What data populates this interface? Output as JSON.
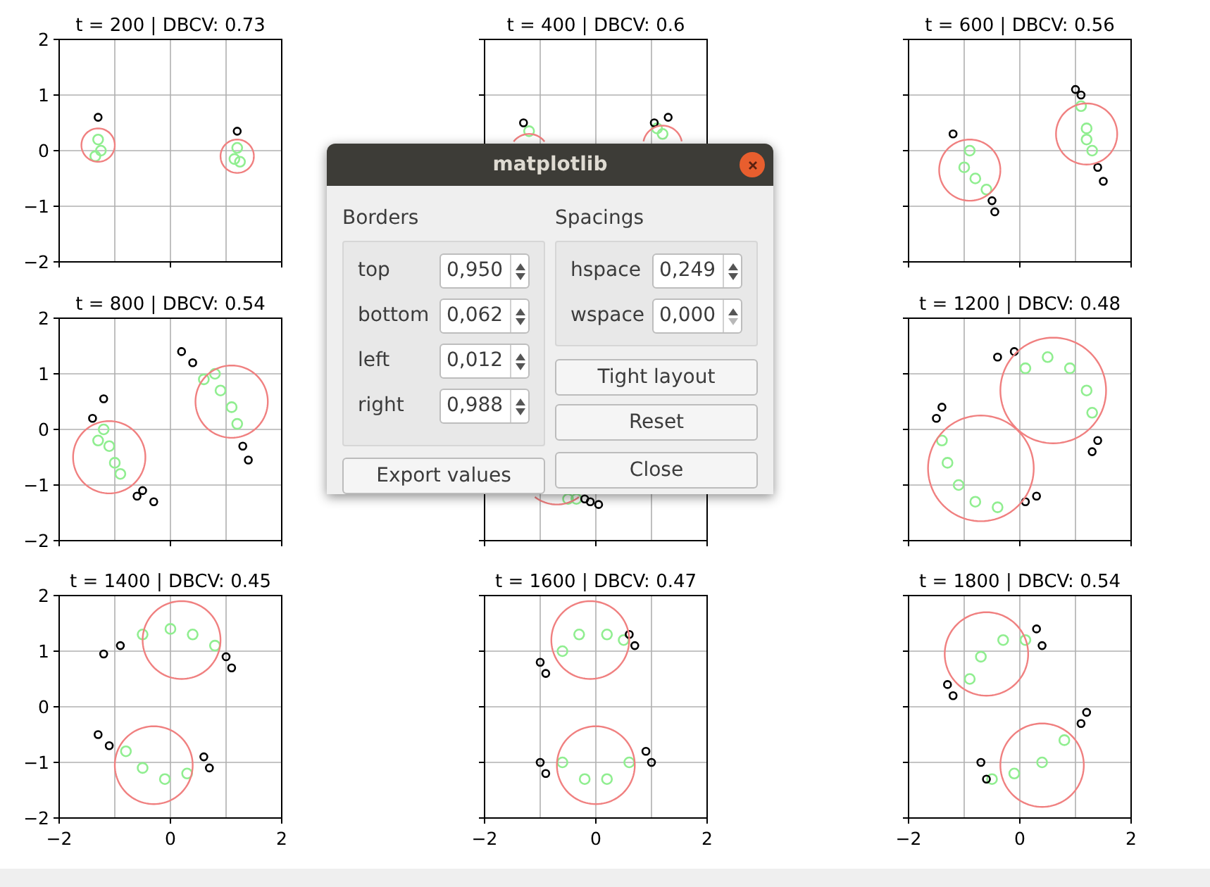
{
  "subplots": [
    {
      "chart_data": {
        "type": "scatter",
        "title": "t = 200 | DBCV: 0.73",
        "grid": true,
        "xlim": [
          -2,
          2
        ],
        "ylim": [
          -2,
          2
        ],
        "yticks": [
          {
            "value": -2,
            "label": "−2"
          },
          {
            "value": -1,
            "label": "−1"
          },
          {
            "value": 0,
            "label": "0"
          },
          {
            "value": 1,
            "label": "1"
          },
          {
            "value": 2,
            "label": "2"
          }
        ],
        "series": [
          {
            "color": "#90ee90",
            "x": [
              -1.3,
              -1.25,
              -1.35,
              1.2,
              1.15,
              1.25
            ],
            "values": [
              0.2,
              0.0,
              -0.1,
              0.05,
              -0.15,
              -0.2
            ]
          },
          {
            "color": "#000000",
            "x": [
              -1.3,
              1.2
            ],
            "values": [
              0.6,
              0.35
            ]
          }
        ]
      }
    },
    {
      "chart_data": {
        "type": "scatter",
        "title": "t = 400 | DBCV: 0.6",
        "grid": true,
        "xlim": [
          -2,
          2
        ],
        "ylim": [
          -2,
          2
        ],
        "series": [
          {
            "color": "#90ee90",
            "x": [
              1.1,
              1.2,
              -1.2
            ],
            "values": [
              0.4,
              0.3,
              0.35
            ]
          },
          {
            "color": "#000000",
            "x": [
              1.3,
              1.05,
              -1.3
            ],
            "values": [
              0.6,
              0.5,
              0.5
            ]
          }
        ]
      }
    },
    {
      "chart_data": {
        "type": "scatter",
        "title": "t = 600 | DBCV: 0.56",
        "grid": true,
        "xlim": [
          -2,
          2
        ],
        "ylim": [
          -2,
          2
        ],
        "series": [
          {
            "color": "#90ee90",
            "x": [
              -0.9,
              -1.0,
              -0.8,
              -0.6,
              1.1,
              1.2,
              1.3,
              1.2
            ],
            "values": [
              0.0,
              -0.3,
              -0.5,
              -0.7,
              0.8,
              0.4,
              0.0,
              0.2
            ]
          },
          {
            "color": "#000000",
            "x": [
              -1.2,
              -0.5,
              -0.45,
              1.0,
              1.1,
              1.4,
              1.5
            ],
            "values": [
              0.3,
              -0.9,
              -1.1,
              1.1,
              1.0,
              -0.3,
              -0.55
            ]
          }
        ]
      }
    },
    {
      "chart_data": {
        "type": "scatter",
        "title": "t = 800 | DBCV: 0.54",
        "grid": true,
        "xlim": [
          -2,
          2
        ],
        "ylim": [
          -2,
          2
        ],
        "yticks": [
          {
            "value": -2,
            "label": "−2"
          },
          {
            "value": -1,
            "label": "−1"
          },
          {
            "value": 0,
            "label": "0"
          },
          {
            "value": 1,
            "label": "1"
          },
          {
            "value": 2,
            "label": "2"
          }
        ],
        "series": [
          {
            "color": "#90ee90",
            "x": [
              -1.2,
              -1.1,
              -1.0,
              -0.9,
              0.6,
              0.9,
              1.1,
              1.2,
              -1.3,
              0.8
            ],
            "values": [
              0.0,
              -0.3,
              -0.6,
              -0.8,
              0.9,
              0.7,
              0.4,
              0.1,
              -0.2,
              1.0
            ]
          },
          {
            "color": "#000000",
            "x": [
              -1.4,
              -1.2,
              -0.6,
              -0.3,
              0.2,
              0.4,
              1.3,
              1.4,
              -0.5
            ],
            "values": [
              0.2,
              0.55,
              -1.2,
              -1.3,
              1.4,
              1.2,
              -0.3,
              -0.55,
              -1.1
            ]
          }
        ]
      }
    },
    {
      "chart_data": {
        "type": "scatter",
        "grid": true,
        "xlim": [
          -2,
          2
        ],
        "ylim": [
          -2,
          2
        ],
        "series": [
          {
            "color": "#90ee90",
            "x": [
              -0.5,
              -0.35
            ],
            "values": [
              -1.25,
              -1.25
            ]
          },
          {
            "color": "#000000",
            "x": [
              -0.1,
              0.05,
              -0.2
            ],
            "values": [
              -1.3,
              -1.35,
              -1.25
            ]
          }
        ]
      }
    },
    {
      "chart_data": {
        "type": "scatter",
        "title": "t = 1200 | DBCV: 0.48",
        "grid": true,
        "xlim": [
          -2,
          2
        ],
        "ylim": [
          -2,
          2
        ],
        "series": [
          {
            "color": "#90ee90",
            "x": [
              0.1,
              0.5,
              0.9,
              1.2,
              1.3,
              -1.3,
              -1.1,
              -0.8,
              -0.4,
              -1.4
            ],
            "values": [
              1.1,
              1.3,
              1.1,
              0.7,
              0.3,
              -0.6,
              -1.0,
              -1.3,
              -1.4,
              -0.2
            ]
          },
          {
            "color": "#000000",
            "x": [
              -0.4,
              -0.1,
              1.4,
              1.3,
              -1.5,
              -1.4,
              0.1,
              0.3
            ],
            "values": [
              1.3,
              1.4,
              -0.2,
              -0.4,
              0.2,
              0.4,
              -1.3,
              -1.2
            ]
          }
        ]
      }
    },
    {
      "chart_data": {
        "type": "scatter",
        "title": "t = 1400 | DBCV: 0.45",
        "grid": true,
        "xlim": [
          -2,
          2
        ],
        "ylim": [
          -2,
          2
        ],
        "xticks": [
          {
            "value": -2,
            "label": "−2"
          },
          {
            "value": 0,
            "label": "0"
          },
          {
            "value": 2,
            "label": "2"
          }
        ],
        "yticks": [
          {
            "value": -2,
            "label": "−2"
          },
          {
            "value": -1,
            "label": "−1"
          },
          {
            "value": 0,
            "label": "0"
          },
          {
            "value": 1,
            "label": "1"
          },
          {
            "value": 2,
            "label": "2"
          }
        ],
        "series": [
          {
            "color": "#90ee90",
            "x": [
              -0.5,
              0.0,
              0.4,
              0.8,
              -0.8,
              -0.5,
              -0.1,
              0.3
            ],
            "values": [
              1.3,
              1.4,
              1.3,
              1.1,
              -0.8,
              -1.1,
              -1.3,
              -1.2
            ]
          },
          {
            "color": "#000000",
            "x": [
              -1.2,
              -0.9,
              1.0,
              1.1,
              -1.3,
              -1.1,
              0.6,
              0.7
            ],
            "values": [
              0.95,
              1.1,
              0.9,
              0.7,
              -0.5,
              -0.7,
              -0.9,
              -1.1
            ]
          }
        ]
      }
    },
    {
      "chart_data": {
        "type": "scatter",
        "title": "t = 1600 | DBCV: 0.47",
        "grid": true,
        "xlim": [
          -2,
          2
        ],
        "ylim": [
          -2,
          2
        ],
        "xticks": [
          {
            "value": -2,
            "label": "−2"
          },
          {
            "value": 0,
            "label": "0"
          },
          {
            "value": 2,
            "label": "2"
          }
        ],
        "series": [
          {
            "color": "#90ee90",
            "x": [
              -0.6,
              -0.3,
              0.2,
              0.5,
              -0.6,
              -0.2,
              0.2,
              0.6
            ],
            "values": [
              1.0,
              1.3,
              1.3,
              1.2,
              -1.0,
              -1.3,
              -1.3,
              -1.0
            ]
          },
          {
            "color": "#000000",
            "x": [
              -1.0,
              -0.9,
              0.6,
              0.7,
              -1.0,
              -0.9,
              0.9,
              1.0
            ],
            "values": [
              0.8,
              0.6,
              1.3,
              1.1,
              -1.0,
              -1.2,
              -0.8,
              -1.0
            ]
          }
        ]
      }
    },
    {
      "chart_data": {
        "type": "scatter",
        "title": "t = 1800 | DBCV: 0.54",
        "grid": true,
        "xlim": [
          -2,
          2
        ],
        "ylim": [
          -2,
          2
        ],
        "xticks": [
          {
            "value": -2,
            "label": "−2"
          },
          {
            "value": 0,
            "label": "0"
          },
          {
            "value": 2,
            "label": "2"
          }
        ],
        "series": [
          {
            "color": "#90ee90",
            "x": [
              -0.9,
              -0.7,
              -0.3,
              0.1,
              -0.5,
              -0.1,
              0.4,
              0.8
            ],
            "values": [
              0.5,
              0.9,
              1.2,
              1.2,
              -1.3,
              -1.2,
              -1.0,
              -0.6
            ]
          },
          {
            "color": "#000000",
            "x": [
              -1.2,
              -1.3,
              0.3,
              0.4,
              -0.7,
              -0.6,
              1.1,
              1.2
            ],
            "values": [
              0.2,
              0.4,
              1.4,
              1.1,
              -1.0,
              -1.3,
              -0.3,
              -0.1
            ]
          }
        ]
      }
    }
  ],
  "dialog": {
    "title": "matplotlib",
    "borders": {
      "label": "Borders",
      "fields": [
        {
          "label": "top",
          "value": "0,950",
          "down_disabled": false
        },
        {
          "label": "bottom",
          "value": "0,062",
          "down_disabled": false
        },
        {
          "label": "left",
          "value": "0,012",
          "down_disabled": false
        },
        {
          "label": "right",
          "value": "0,988",
          "down_disabled": false
        }
      ]
    },
    "spacings": {
      "label": "Spacings",
      "fields": [
        {
          "label": "hspace",
          "value": "0,249",
          "down_disabled": false
        },
        {
          "label": "wspace",
          "value": "0,000",
          "down_disabled": true
        }
      ]
    },
    "side_buttons": [
      "Tight layout",
      "Reset"
    ],
    "bottom_buttons": [
      "Export values",
      "Close"
    ]
  }
}
